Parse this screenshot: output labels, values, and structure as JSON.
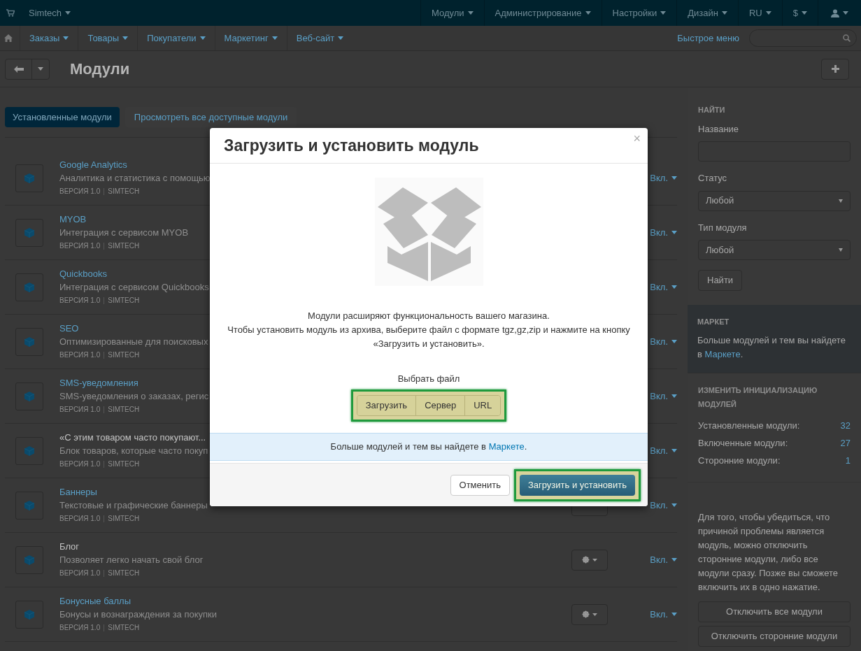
{
  "top_bar": {
    "brand": "Simtech",
    "menus": [
      "Модули",
      "Администрирование",
      "Настройки",
      "Дизайн",
      "RU",
      "$"
    ]
  },
  "nav": {
    "items": [
      "Заказы",
      "Товары",
      "Покупатели",
      "Маркетинг",
      "Веб-сайт"
    ],
    "quick_menu": "Быстрое меню"
  },
  "page": {
    "title": "Модули"
  },
  "tabs": [
    {
      "label": "Установленные модули",
      "selected": true
    },
    {
      "label": "Просмотреть все доступные модули",
      "selected": false
    }
  ],
  "modules": [
    {
      "title": "Google Analytics",
      "linked": true,
      "description": "Аналитика и статистика с помощью",
      "version": "ВЕРСИЯ 1.0",
      "vendor": "SIMTECH",
      "status": "Вкл.",
      "gear": false
    },
    {
      "title": "MYOB",
      "linked": true,
      "description": "Интеграция с сервисом MYOB",
      "version": "ВЕРСИЯ 1.0",
      "vendor": "SIMTECH",
      "status": "Вкл.",
      "gear": false
    },
    {
      "title": "Quickbooks",
      "linked": true,
      "description": "Интеграция с сервисом Quickbooks",
      "version": "ВЕРСИЯ 1.0",
      "vendor": "SIMTECH",
      "status": "Вкл.",
      "gear": false
    },
    {
      "title": "SEO",
      "linked": true,
      "description": "Оптимизированные для поисковых",
      "version": "ВЕРСИЯ 1.0",
      "vendor": "SIMTECH",
      "status": "Вкл.",
      "gear": false
    },
    {
      "title": "SMS-уведомления",
      "linked": true,
      "description": "SMS-уведомления о заказах, регис",
      "version": "ВЕРСИЯ 1.0",
      "vendor": "SIMTECH",
      "status": "Вкл.",
      "gear": false
    },
    {
      "title": "«С этим товаром часто покупают...",
      "linked": false,
      "description": "Блок товаров, которые часто покуп",
      "version": "ВЕРСИЯ 1.0",
      "vendor": "SIMTECH",
      "status": "Вкл.",
      "gear": false
    },
    {
      "title": "Баннеры",
      "linked": true,
      "description": "Текстовые и графические баннеры",
      "version": "ВЕРСИЯ 1.0",
      "vendor": "SIMTECH",
      "status": "Вкл.",
      "gear": true
    },
    {
      "title": "Блог",
      "linked": false,
      "description": "Позволяет легко начать свой блог",
      "version": "ВЕРСИЯ 1.0",
      "vendor": "SIMTECH",
      "status": "Вкл.",
      "gear": true
    },
    {
      "title": "Бонусные баллы",
      "linked": true,
      "description": "Бонусы и вознаграждения за покупки",
      "version": "ВЕРСИЯ 1.0",
      "vendor": "SIMTECH",
      "status": "Вкл.",
      "gear": true
    }
  ],
  "sidebar": {
    "search_heading": "НАЙТИ",
    "name_label": "Название",
    "status_label": "Статус",
    "status_value": "Любой",
    "type_label": "Тип модуля",
    "type_value": "Любой",
    "find_button": "Найти",
    "market": {
      "heading": "МАРКЕТ",
      "text": "Больше модулей и тем вы найдете в",
      "link": "Маркете",
      "after": "."
    },
    "init_heading": "ИЗМЕНИТЬ ИНИЦИАЛИЗАЦИЮ МОДУЛЕЙ",
    "stats": [
      {
        "label": "Установленные модули:",
        "value": "32"
      },
      {
        "label": "Включенные модули:",
        "value": "27"
      },
      {
        "label": "Сторонние модули:",
        "value": "1"
      }
    ],
    "note": "Для того, чтобы убедиться, что причиной проблемы является модуль, можно отключить сторонние модули, либо все модули сразу. Позже вы сможете включить их в одно нажатие.",
    "buttons": [
      "Отключить все модули",
      "Отключить сторонние модули"
    ]
  },
  "modal": {
    "title": "Загрузить и установить модуль",
    "close": "×",
    "intro": [
      "Модули расширяют функциональность вашего магазина.",
      "Чтобы установить модуль из архива, выберите файл с формате tgz,gz,zip и нажмите на кнопку «Загрузить и установить»."
    ],
    "file_label": "Выбрать файл",
    "sources": [
      "Загрузить",
      "Сервер",
      "URL"
    ],
    "info": {
      "text": "Больше модулей и тем вы найдете в",
      "link": "Маркете",
      "after": "."
    },
    "cancel": "Отменить",
    "submit": "Загрузить и установить"
  }
}
